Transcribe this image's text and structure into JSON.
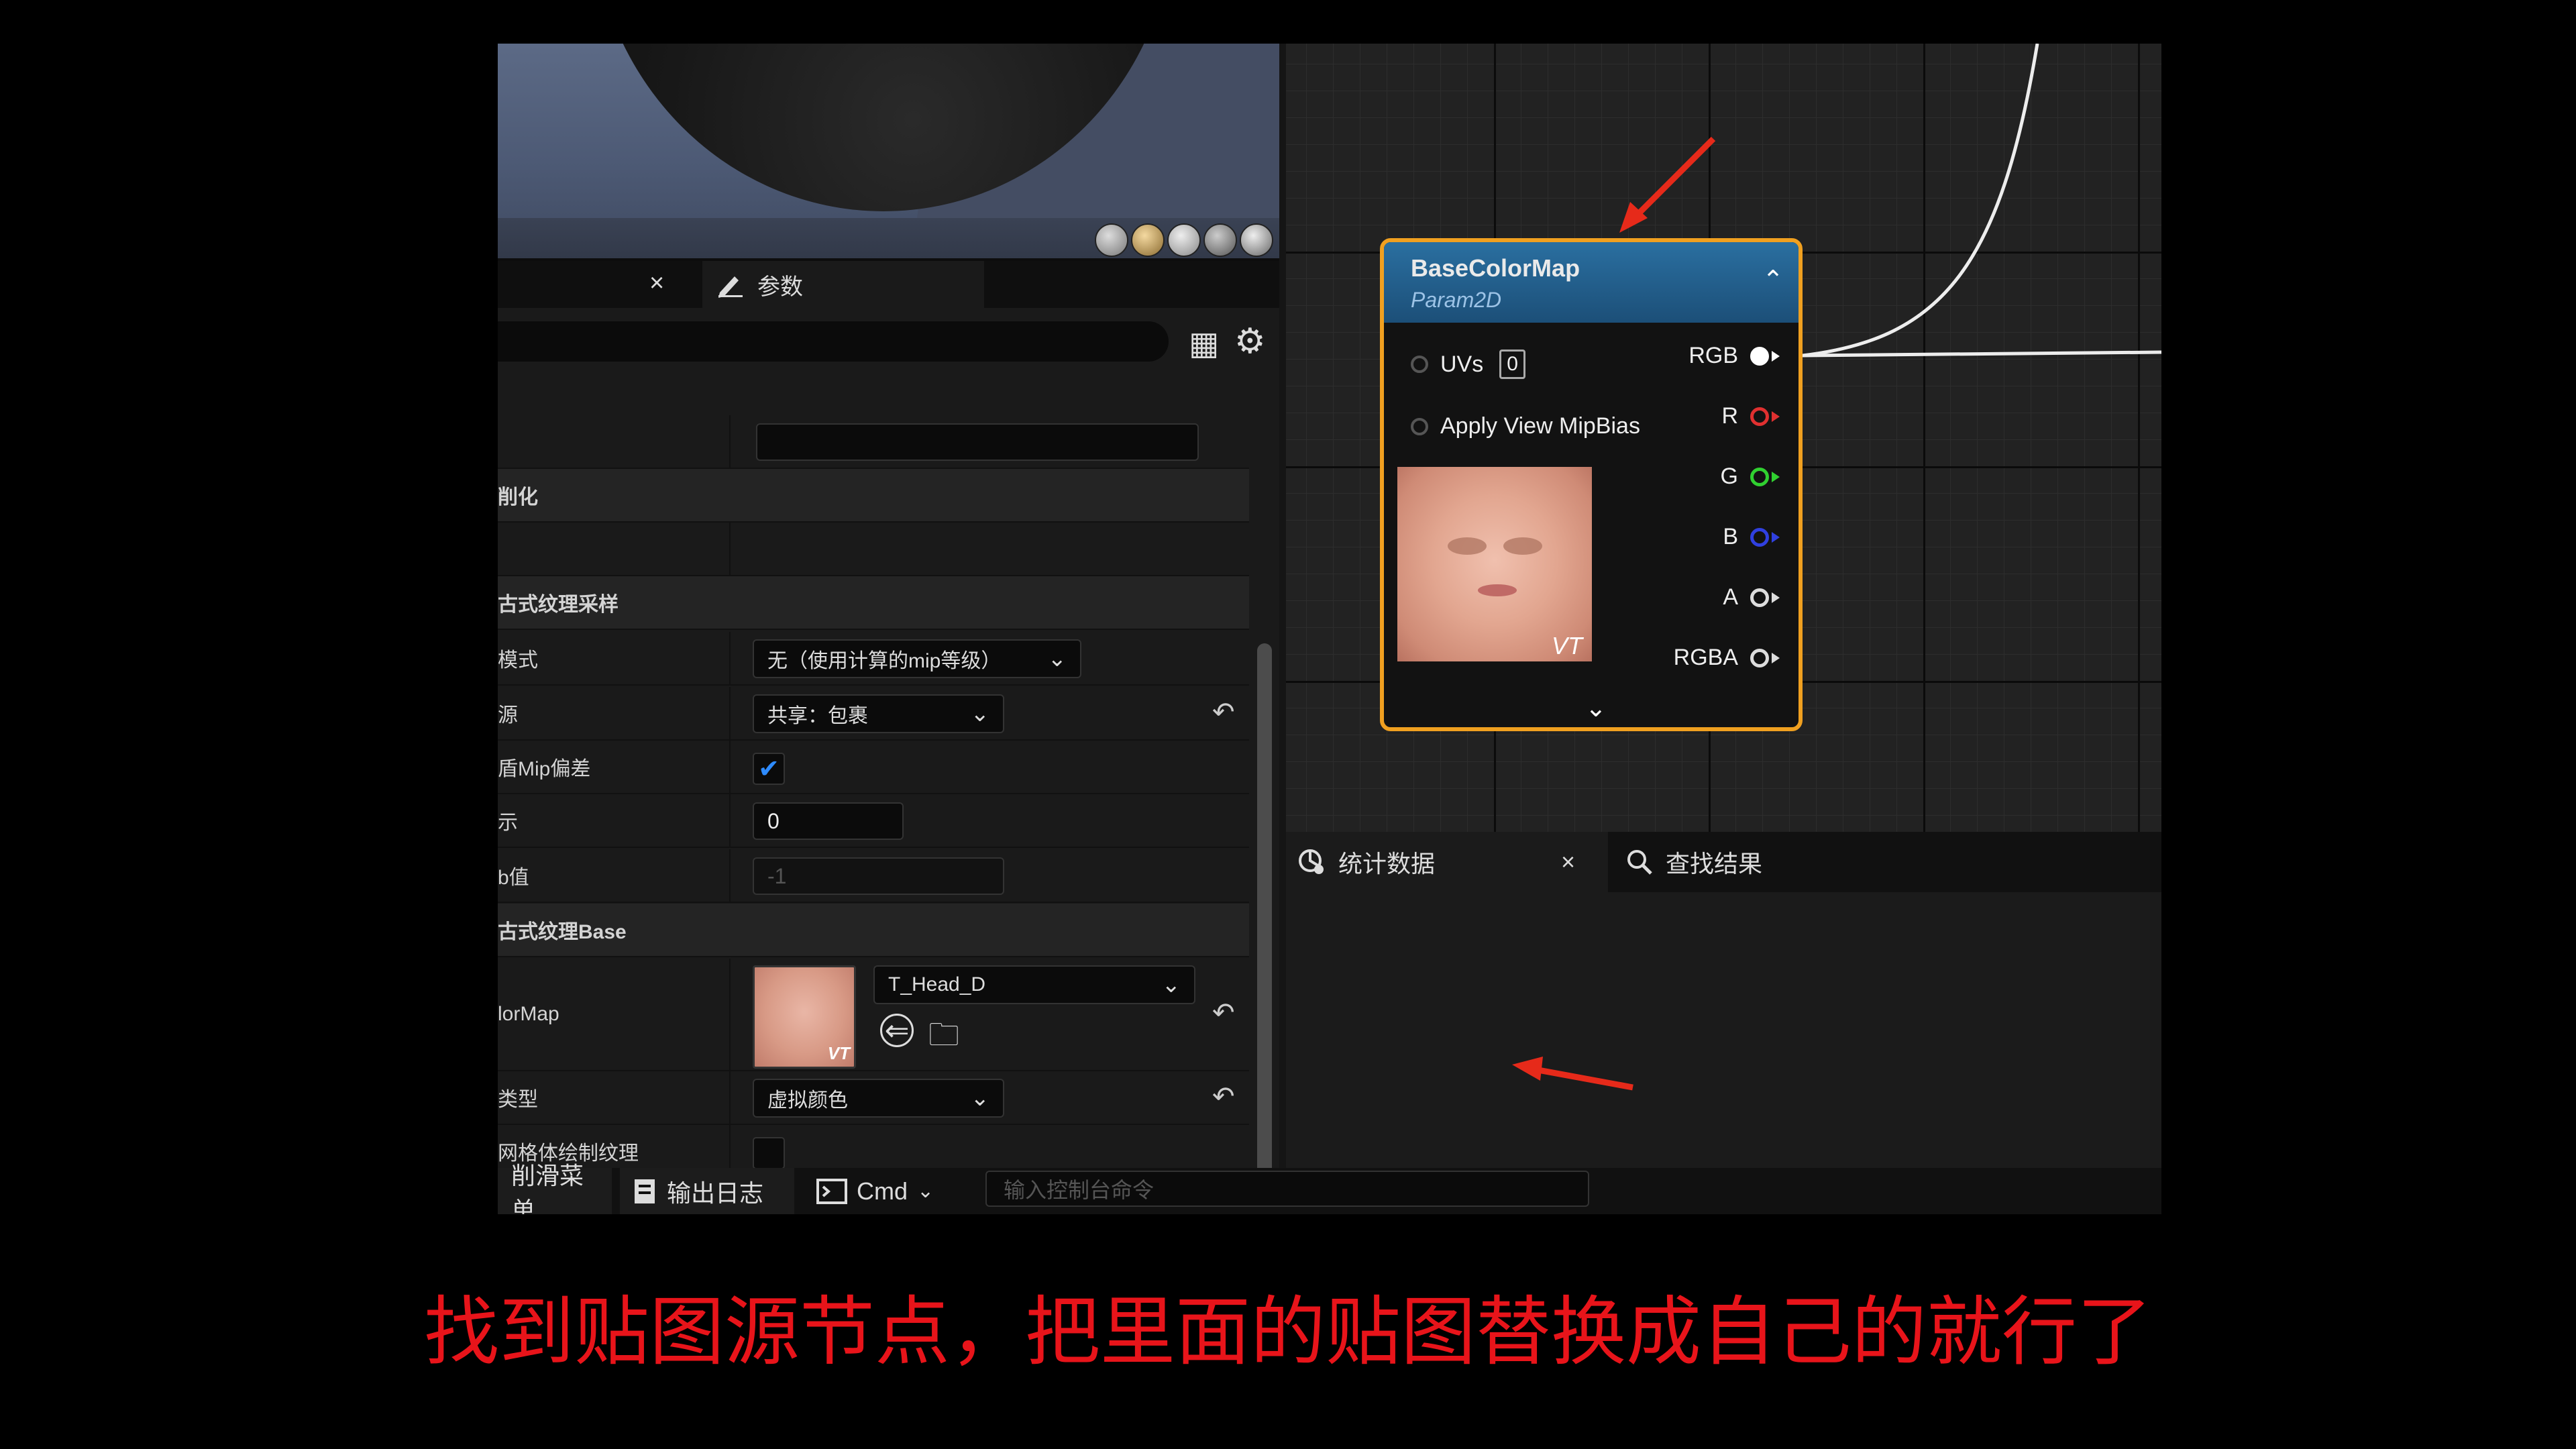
{
  "details": {
    "tab_params_label": "参数",
    "rows": [
      {
        "label": "",
        "type": "text"
      },
      {
        "label": "削化",
        "type": "category"
      },
      {
        "label": "",
        "type": "empty"
      },
      {
        "label": "古式纹理采样",
        "type": "category"
      },
      {
        "label": "模式",
        "type": "combo",
        "value": "无（使用计算的mip等级）"
      },
      {
        "label": "源",
        "type": "combo",
        "value": "共享：包裹"
      },
      {
        "label": "盾Mip偏差",
        "type": "check",
        "value": "checked"
      },
      {
        "label": "示",
        "type": "number",
        "value": "0"
      },
      {
        "label": "b值",
        "type": "number",
        "value": "-1"
      },
      {
        "label": "古式纹理Base",
        "type": "category"
      },
      {
        "label": "lorMap",
        "type": "texture",
        "value": "T_Head_D"
      },
      {
        "label": "类型",
        "type": "combo",
        "value": "虚拟颜色"
      },
      {
        "label": "网格体绘制纹理",
        "type": "check",
        "value": "unchecked"
      }
    ],
    "thumb_badge": "VT"
  },
  "bottombar": {
    "tab1": "削滑菜单",
    "tab2": "输出日志",
    "tab3": "Cmd",
    "cmd_placeholder": "输入控制台命令"
  },
  "node": {
    "title": "BaseColorMap",
    "subtitle": "Param2D",
    "inputs": [
      {
        "label": "UVs",
        "box": "0"
      },
      {
        "label": "Apply View MipBias"
      }
    ],
    "outputs": [
      {
        "label": "RGB",
        "color": "#ffffff",
        "filled": true
      },
      {
        "label": "R",
        "color": "#e03030"
      },
      {
        "label": "G",
        "color": "#30d030"
      },
      {
        "label": "B",
        "color": "#3040e0"
      },
      {
        "label": "A",
        "color": "#dddddd"
      },
      {
        "label": "RGBA",
        "color": "#dddddd"
      }
    ],
    "thumb_badge": "VT"
  },
  "stats": {
    "tab1": "统计数据",
    "tab2": "查找结果"
  },
  "caption": "找到贴图源节点，把里面的贴图替换成自己的就行了",
  "colors": {
    "accent_orange": "#f0a020",
    "caption_red": "#e8141a",
    "annotation_red": "#e62a1a"
  }
}
